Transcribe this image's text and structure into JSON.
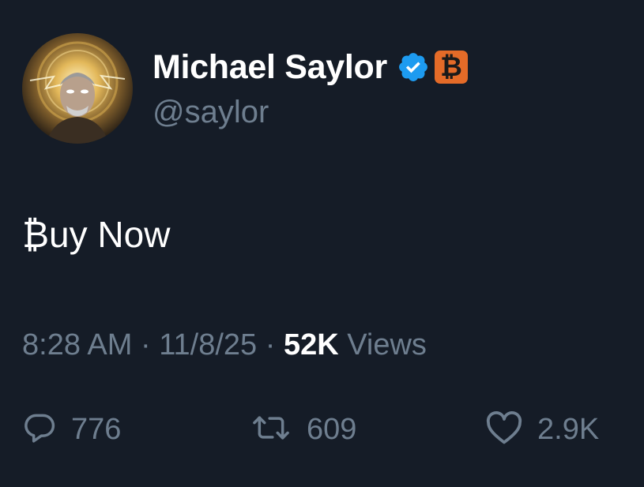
{
  "user": {
    "display_name": "Michael Saylor",
    "handle": "@saylor",
    "verified_icon": "verified-badge-icon",
    "affiliate_badge": "₿",
    "badge_color": "#e46b28",
    "verified_color": "#1d9bf0"
  },
  "tweet": {
    "text": "₿uy Now"
  },
  "meta": {
    "time": "8:28 AM",
    "sep1": " · ",
    "date": "11/8/25",
    "sep2": " · ",
    "views_count": "52K",
    "views_label": " Views"
  },
  "actions": {
    "reply": {
      "icon": "reply-icon",
      "count": "776"
    },
    "retweet": {
      "icon": "retweet-icon",
      "count": "609"
    },
    "like": {
      "icon": "heart-icon",
      "count": "2.9K"
    }
  },
  "colors": {
    "background": "#151c27",
    "muted_text": "#6e7e8f",
    "text": "#ffffff"
  }
}
